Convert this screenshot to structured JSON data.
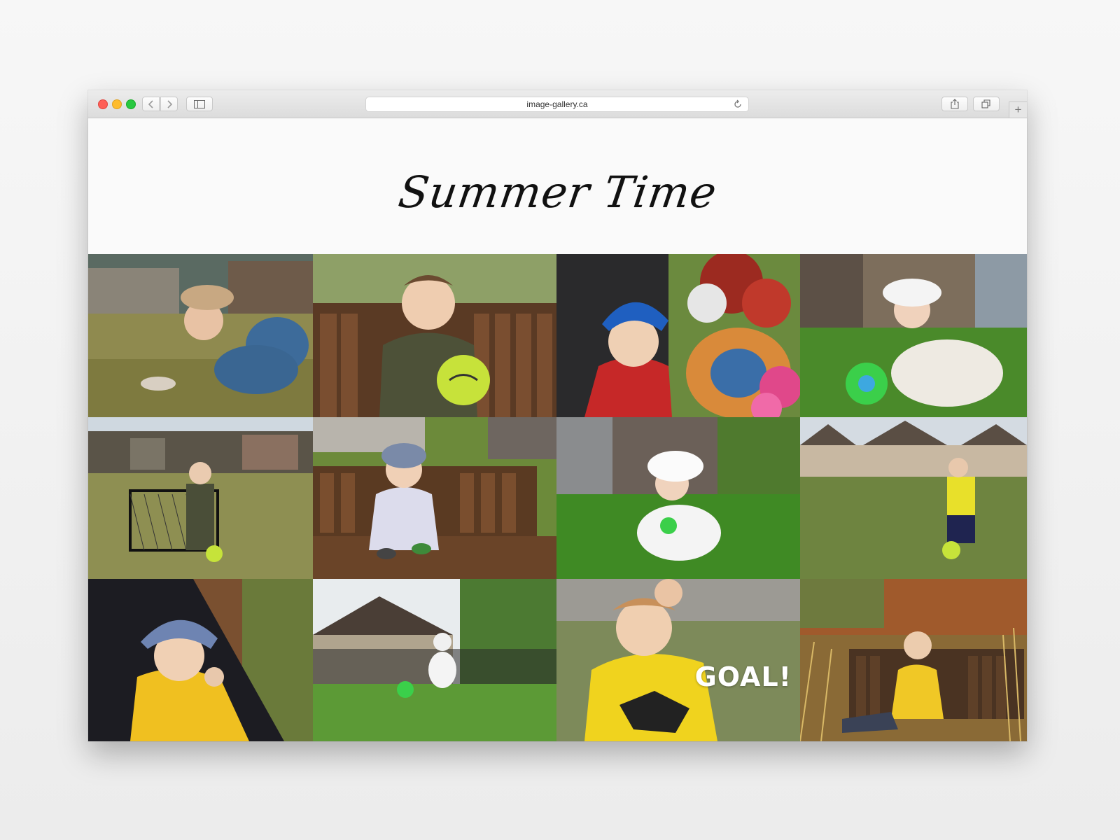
{
  "browser": {
    "url": "image-gallery.ca",
    "icons": [
      "back-icon",
      "forward-icon",
      "sidebar-icon",
      "reload-icon",
      "share-icon",
      "tabs-icon",
      "new-tab-icon"
    ],
    "new_tab_label": "+"
  },
  "page": {
    "title": "Summer Time"
  },
  "gallery": {
    "photos": [
      {
        "subject": "baby crawling on grass with bow headband"
      },
      {
        "subject": "toddler on bench holding green ball"
      },
      {
        "subject": "toddler in blue hat in stroller with flowers"
      },
      {
        "subject": "baby in white hat pushing green ball"
      },
      {
        "subject": "toddler by small soccer goal"
      },
      {
        "subject": "toddler in bucket hat on bench"
      },
      {
        "subject": "baby in white hat sitting in grass"
      },
      {
        "subject": "toddler kicking ball in field"
      },
      {
        "subject": "toddler in stroller with bucket hat"
      },
      {
        "subject": "baby kicking ball in backyard"
      },
      {
        "subject": "toddler celebrating",
        "caption": "GOAL!"
      },
      {
        "subject": "toddler on bench in tall grass"
      }
    ]
  }
}
